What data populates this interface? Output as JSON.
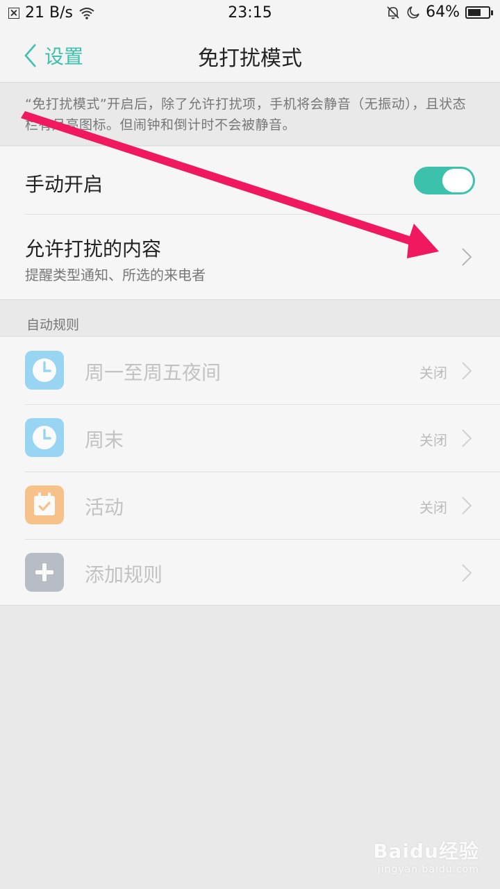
{
  "status_bar": {
    "speed": "21 B/s",
    "time": "23:15",
    "battery": "64%",
    "battery_level": 0.64,
    "icons": [
      "notification-x-icon",
      "wifi-icon",
      "bell-muted-icon",
      "moon-icon",
      "battery-icon"
    ]
  },
  "header": {
    "back_label": "设置",
    "title": "免打扰模式"
  },
  "description": "“免打扰模式”开启后，除了允许打扰项，手机将会静音（无振动），且状态栏有月亮图标。但闹钟和倒计时不会被静音。",
  "manual": {
    "label": "手动开启",
    "enabled": true
  },
  "allowed": {
    "label": "允许打扰的内容",
    "sub": "提醒类型通知、所选的来电者"
  },
  "auto_rules": {
    "section_title": "自动规则",
    "rules": [
      {
        "label": "周一至周五夜间",
        "status": "关闭",
        "icon": "clock-icon",
        "color": "#5bc0f2"
      },
      {
        "label": "周末",
        "status": "关闭",
        "icon": "clock-icon",
        "color": "#5bc0f2"
      },
      {
        "label": "活动",
        "status": "关闭",
        "icon": "calendar-icon",
        "color": "#f7a043"
      },
      {
        "label": "添加规则",
        "status": "",
        "icon": "plus-icon",
        "color": "#8e96a6"
      }
    ]
  },
  "colors": {
    "accent": "#3cc1ac",
    "arrow": "#f0195f"
  },
  "watermark": {
    "brand": "Baidu经验",
    "url": "jingyan.baidu.com"
  }
}
